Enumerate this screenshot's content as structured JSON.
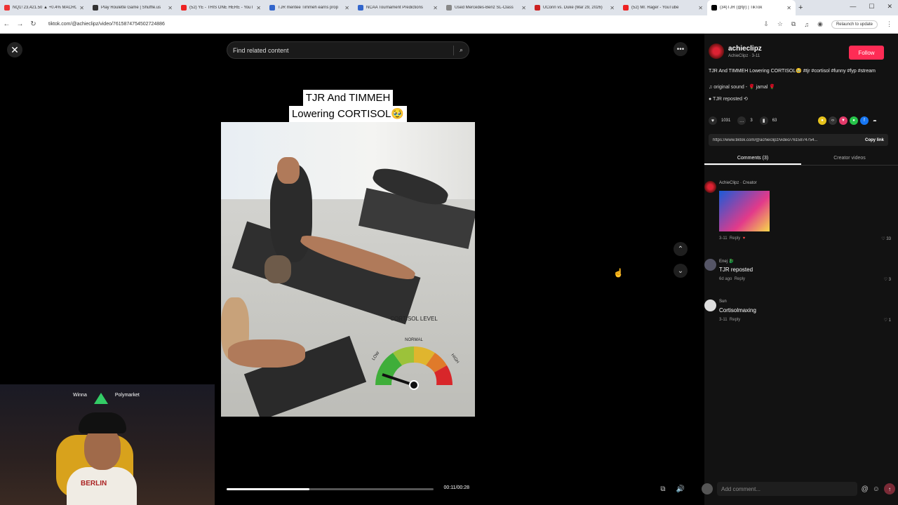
{
  "browser": {
    "tabs": [
      {
        "title": "NQ1! 23,421.50 ▲ +0.4% MACRO",
        "color": "#e33",
        "active": false
      },
      {
        "title": "Play Roulette Game | Shuffle.us",
        "color": "#333",
        "active": false
      },
      {
        "title": "(52) YE - THIS ONE HERE - YouTube",
        "color": "#e22",
        "active": false
      },
      {
        "title": "TJR mentee Timmeh earns prop",
        "color": "#36c",
        "active": false
      },
      {
        "title": "NCAA Tournament Predictions",
        "color": "#36c",
        "active": false
      },
      {
        "title": "Used Mercedes-Benz SL-Class",
        "color": "#888",
        "active": false
      },
      {
        "title": "UConn vs. Duke (Mar 29, 2026)",
        "color": "#c22",
        "active": false
      },
      {
        "title": "(52) Mr. Rager - YouTube",
        "color": "#e22",
        "active": false
      },
      {
        "title": "(34)TJR (@tjr) | TikTok",
        "color": "#000",
        "active": true
      }
    ],
    "url": "tiktok.com/@achieclipz/video/7615874754502724886",
    "relaunch": "Relaunch to update"
  },
  "video": {
    "search_placeholder": "Find related content",
    "caption_line1": "TJR And TIMMEH",
    "caption_line2": "Lowering CORTISOL🥹",
    "gauge_title": "CORTISOL LEVEL",
    "gauge_normal": "NORMAL",
    "gauge_low": "LOW",
    "gauge_high": "HIGH",
    "progress_fraction": 0.4,
    "time": "00:11/00:28"
  },
  "sidebar": {
    "username": "achieclipz",
    "subline": "AchieClipz · 3-11",
    "follow": "Follow",
    "description": "TJR And TIMMEH Lowering CORTISOL🥹 #tjr #cortisol #funny #fyp #stream",
    "sound": "original sound - 🌹 jamal 🌹",
    "repost": "TJR reposted",
    "likes": "1031",
    "comments_count": "3",
    "saves": "63",
    "link": "https://www.tiktok.com/@achieclipz/video/7615874754...",
    "copy_link": "Copy link",
    "tab_comments": "Comments (3)",
    "tab_creator": "Creator videos"
  },
  "comments": [
    {
      "name": "AchieClipz · Creator",
      "text": "",
      "meta": "3-11",
      "reply": "Reply",
      "likes": "33"
    },
    {
      "name": "Enej 🐉",
      "text": "TJR reposted",
      "meta": "6d ago",
      "reply": "Reply",
      "likes": "3"
    },
    {
      "name": "Sun",
      "text": "Cortisolmaxing",
      "meta": "3-11",
      "reply": "Reply",
      "likes": "1"
    }
  ],
  "add_comment_placeholder": "Add comment...",
  "webcam": {
    "sponsor1": "Winna",
    "sponsor2": "Polymarket",
    "shirt_text": "BERLIN"
  }
}
